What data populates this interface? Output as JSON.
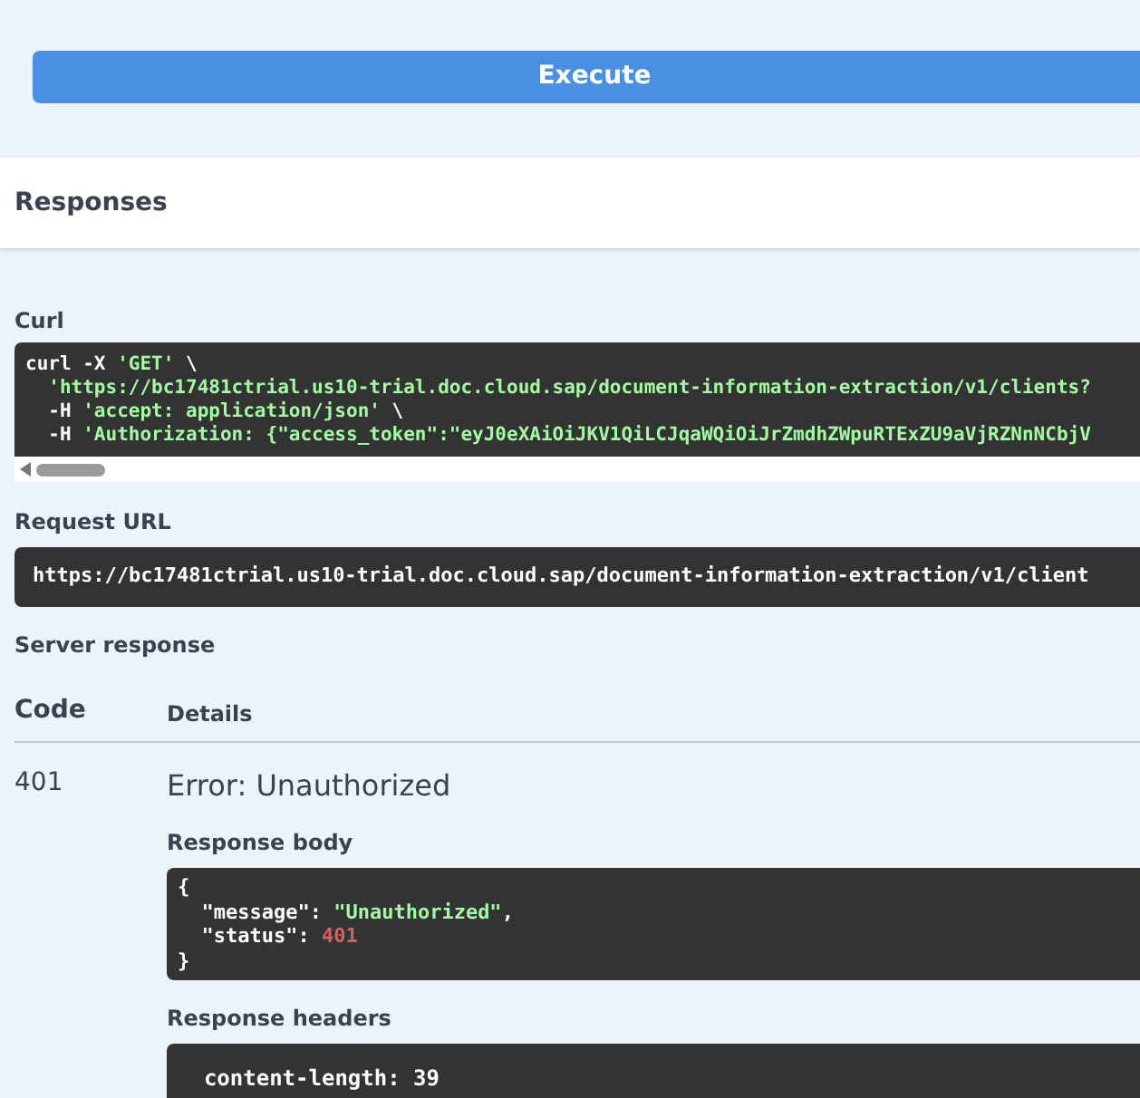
{
  "execute_button": {
    "label": "Execute"
  },
  "responses_title": "Responses",
  "curl": {
    "label": "Curl",
    "lines": [
      [
        {
          "kind": "plain",
          "text": "curl -X "
        },
        {
          "kind": "string",
          "text": "'GET'"
        },
        {
          "kind": "plain",
          "text": " \\"
        }
      ],
      [
        {
          "kind": "string",
          "text": "  'https://bc17481ctrial.us10-trial.doc.cloud.sap/document-information-extraction/v1/clients?"
        }
      ],
      [
        {
          "kind": "plain",
          "text": "  -H "
        },
        {
          "kind": "string",
          "text": "'accept: application/json'"
        },
        {
          "kind": "plain",
          "text": " \\"
        }
      ],
      [
        {
          "kind": "plain",
          "text": "  -H "
        },
        {
          "kind": "string",
          "text": "'Authorization: {\"access_token\":\"eyJ0eXAiOiJKV1QiLCJqaWQiOiJrZmdhZWpuRTExZU9aVjRZNnNCbjV"
        }
      ]
    ]
  },
  "request_url": {
    "label": "Request URL",
    "value": "https://bc17481ctrial.us10-trial.doc.cloud.sap/document-information-extraction/v1/client"
  },
  "server_response": {
    "label": "Server response",
    "columns": [
      "Code",
      "Details"
    ],
    "code": "401",
    "error": "Error: Unauthorized",
    "body_label": "Response body",
    "body_lines": [
      [
        {
          "kind": "plain",
          "text": "{"
        }
      ],
      [
        {
          "kind": "plain",
          "text": "  \"message\": "
        },
        {
          "kind": "string",
          "text": "\"Unauthorized\""
        },
        {
          "kind": "plain",
          "text": ","
        }
      ],
      [
        {
          "kind": "plain",
          "text": "  \"status\": "
        },
        {
          "kind": "number",
          "text": "401"
        }
      ],
      [
        {
          "kind": "plain",
          "text": "}"
        }
      ]
    ],
    "headers_label": "Response headers",
    "header_lines": [
      "  content-length: 39"
    ]
  }
}
